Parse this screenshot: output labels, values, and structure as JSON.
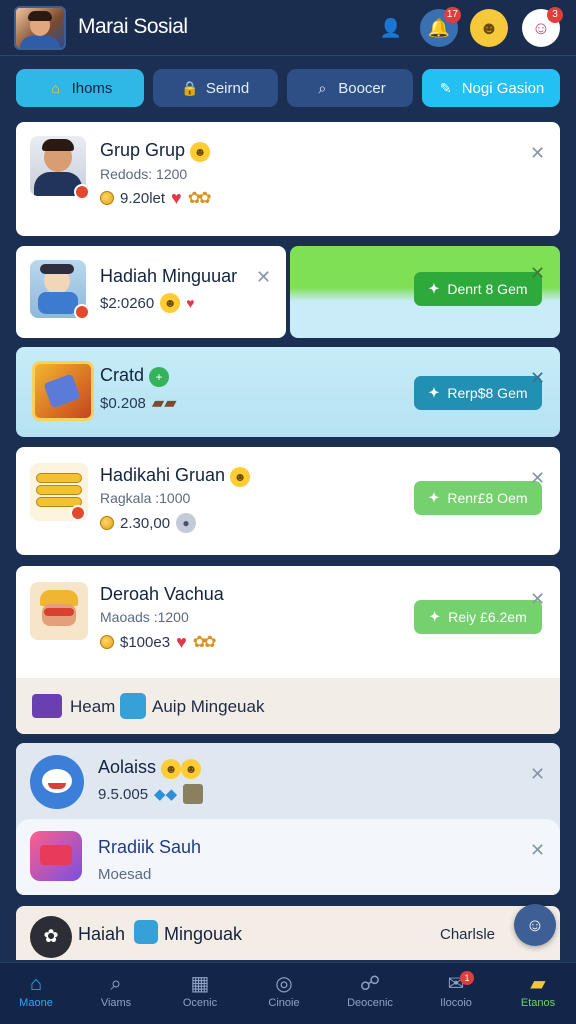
{
  "header": {
    "title": "Marai Sosial",
    "icons": [
      {
        "name": "profile-icon",
        "glyph": "👤"
      },
      {
        "name": "notifications-icon",
        "glyph": "🔔",
        "badge": "17"
      },
      {
        "name": "emoji-icon",
        "glyph": "☻"
      },
      {
        "name": "messages-icon",
        "glyph": "☺",
        "badge": "3"
      }
    ]
  },
  "tabs": [
    {
      "label": "Ihoms",
      "icon": "home-icon",
      "glyph": "⌂"
    },
    {
      "label": "Seirnd",
      "icon": "lock-icon",
      "glyph": "🔒"
    },
    {
      "label": "Boocer",
      "icon": "search-icon",
      "glyph": "⌕"
    },
    {
      "label": "Nogi Gasion",
      "icon": "chat-icon",
      "glyph": "✎"
    }
  ],
  "cards": {
    "c1": {
      "title": "Grup Grup",
      "sub": "Redods: 1200",
      "amount": "9.20let"
    },
    "c2": {
      "title": "Hadiah Minguuar",
      "amount": "$2:0260"
    },
    "c3": {
      "title": "Cratd",
      "amount": "$0.208",
      "claim": "Rerp$8 Gem"
    },
    "c2b": {
      "claim": "Denrt 8 Gem"
    },
    "c4": {
      "title": "Hadikahi Gruan",
      "sub": "Ragkala :1000",
      "amount": "2.30,00",
      "claim": "Renr£8 Oem"
    },
    "c5": {
      "title": "Deroah Vachua",
      "sub": "Maoads :1200",
      "amount": "$100e3",
      "claim": "Reiy £6.2em"
    },
    "c5_footer": {
      "left": "Heam",
      "right": "Auip Mingeuak"
    },
    "c6": {
      "title": "Aolaiss",
      "amount": "9.5.005"
    },
    "c7": {
      "title": "Rradiik Sauh",
      "sub": "Moesad"
    },
    "c8": {
      "title": "Haiah",
      "title2": "Mingouak",
      "right": "Charlsle"
    }
  },
  "nav": [
    {
      "label": "Maone",
      "icon": "home-icon",
      "glyph": "⌂"
    },
    {
      "label": "Viams",
      "icon": "search-icon",
      "glyph": "⌕"
    },
    {
      "label": "Ocenic",
      "icon": "grid-icon",
      "glyph": "▦"
    },
    {
      "label": "Cinoie",
      "icon": "circle-icon",
      "glyph": "◎"
    },
    {
      "label": "Deocenic",
      "icon": "people-icon",
      "glyph": "☍"
    },
    {
      "label": "Ilocoio",
      "icon": "chat-bubble-icon",
      "glyph": "✉",
      "badge": "1"
    },
    {
      "label": "Etanos",
      "icon": "folder-icon",
      "glyph": "▰"
    }
  ],
  "colors": {
    "background": "#1b2f52",
    "accent": "#2fb7e6",
    "claim_green": "#2eaa3c",
    "claim_teal": "#2190b3",
    "claim_light_green": "#74d16e"
  }
}
